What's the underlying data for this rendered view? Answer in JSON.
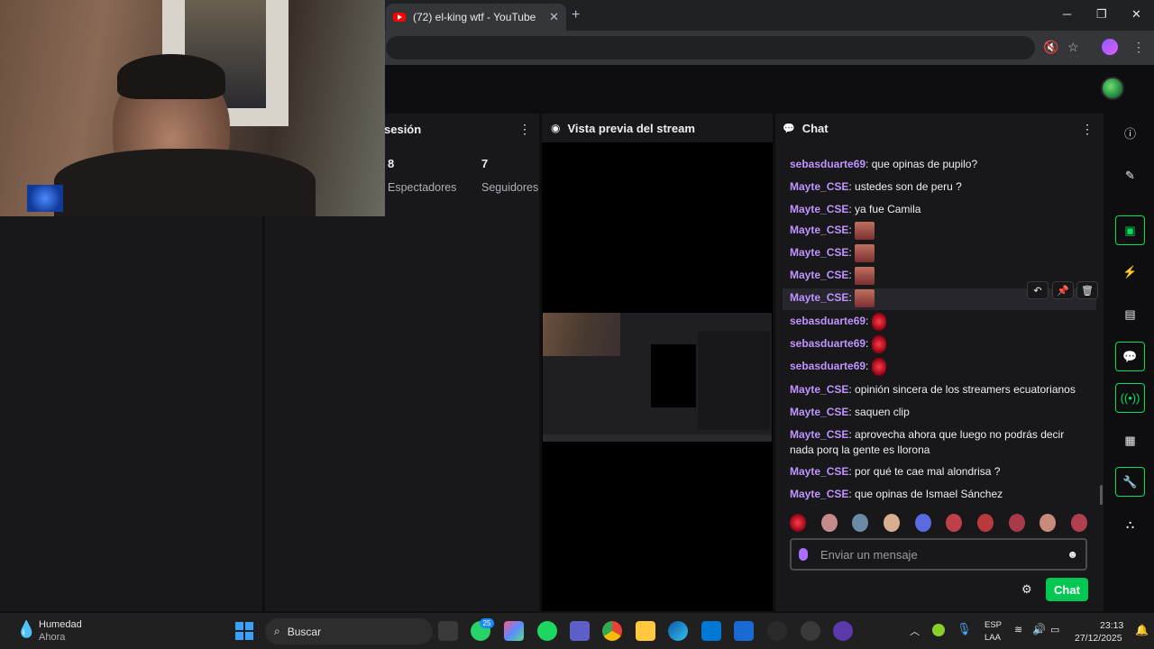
{
  "browser": {
    "tab_title": "(72) el-king wtf - YouTube",
    "tab_close": "✕",
    "new_tab": "+",
    "window_controls": [
      "─",
      "❐",
      "✕"
    ]
  },
  "session_panel": {
    "title": "sesión",
    "menu": "⋮",
    "viewers_value": "8",
    "viewers_label": "Espectadores",
    "followers_value": "7",
    "followers_label": "Seguidores"
  },
  "preview_panel": {
    "title": "Vista previa del stream"
  },
  "chat": {
    "title": "Chat",
    "menu": "⋮",
    "messages": [
      {
        "user": "sebasduarte69",
        "text": "que opinas de pupilo?"
      },
      {
        "user": "Mayte_CSE",
        "text": "ustedes son de peru ?"
      },
      {
        "user": "Mayte_CSE",
        "text": "ya fue Camila"
      },
      {
        "user": "Mayte_CSE",
        "text": ""
      },
      {
        "user": "Mayte_CSE",
        "text": ""
      },
      {
        "user": "Mayte_CSE",
        "text": ""
      },
      {
        "user": "Mayte_CSE",
        "text": ""
      },
      {
        "user": "sebasduarte69",
        "text": ""
      },
      {
        "user": "sebasduarte69",
        "text": ""
      },
      {
        "user": "sebasduarte69",
        "text": ""
      },
      {
        "user": "Mayte_CSE",
        "text": "opinión sincera de los streamers ecuatorianos"
      },
      {
        "user": "Mayte_CSE",
        "text": "saquen clip"
      },
      {
        "user": "Mayte_CSE",
        "text": "aprovecha ahora que luego no podrás decir nada porq la gente es llorona"
      },
      {
        "user": "Mayte_CSE",
        "text": "por qué te cae mal alondrisa ?"
      },
      {
        "user": "Mayte_CSE",
        "text": "que opinas de Ismael Sánchez"
      }
    ],
    "separator": ": ",
    "input_placeholder": "Enviar un mensaje",
    "send_label": "Chat",
    "hover_tools": [
      "↶",
      "📌",
      "🗑"
    ]
  },
  "taskbar": {
    "weather_title": "Humedad",
    "weather_sub": "Ahora",
    "search_label": "Buscar",
    "whatsapp_badge": "25",
    "lang_top": "ESP",
    "lang_bottom": "LAA",
    "time": "23:13",
    "date": "27/12/2025"
  },
  "colors": {
    "username": "#bf94ff",
    "accent_green": "#00c853",
    "panel_bg": "#18181b"
  }
}
